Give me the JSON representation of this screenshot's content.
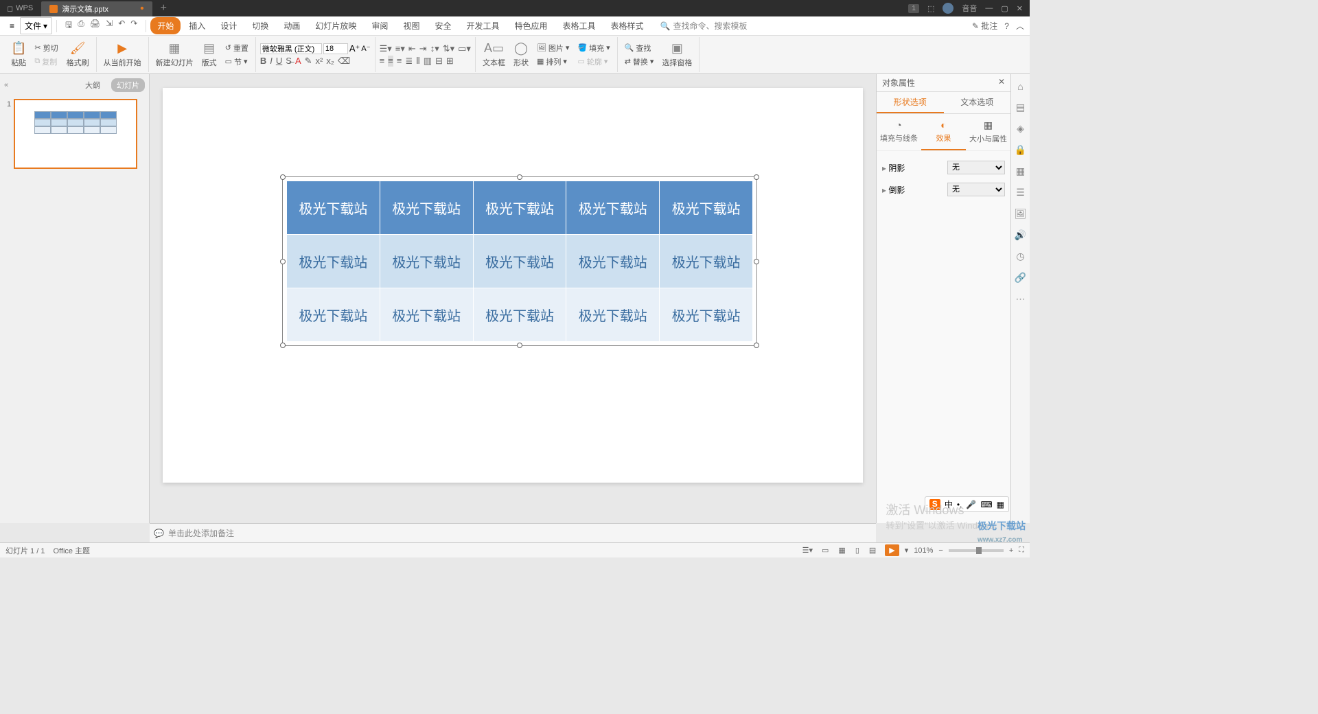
{
  "titlebar": {
    "app": "WPS",
    "doc_name": "演示文稿.pptx",
    "badge": "1",
    "username": "音音"
  },
  "menubar": {
    "file": "文件",
    "tabs": [
      "开始",
      "插入",
      "设计",
      "切换",
      "动画",
      "幻灯片放映",
      "审阅",
      "视图",
      "安全",
      "开发工具",
      "特色应用",
      "表格工具",
      "表格样式"
    ],
    "active_tab": 0,
    "search_placeholder": "查找命令、搜索模板",
    "annotate": "批注"
  },
  "ribbon": {
    "paste": "粘贴",
    "cut": "剪切",
    "copy": "复制",
    "format_painter": "格式刷",
    "from_start": "从当前开始",
    "new_slide": "新建幻灯片",
    "layout": "版式",
    "section": "节",
    "reset": "重置",
    "font_name": "微软雅黑 (正文)",
    "font_size": "18",
    "textbox": "文本框",
    "shape": "形状",
    "picture": "图片",
    "arrange": "排列",
    "fill": "填充",
    "outline": "轮廓",
    "find": "查找",
    "replace": "替换",
    "select_pane": "选择窗格"
  },
  "thumbpane": {
    "outline": "大纲",
    "slides": "幻灯片",
    "slide_number": "1"
  },
  "slide": {
    "cell_text": "极光下载站"
  },
  "proppane": {
    "title": "对象属性",
    "tab_shape": "形状选项",
    "tab_text": "文本选项",
    "sub_fill": "填充与线条",
    "sub_effect": "效果",
    "sub_size": "大小与属性",
    "shadow": "阴影",
    "reflection": "倒影",
    "none": "无"
  },
  "notes": {
    "placeholder": "单击此处添加备注"
  },
  "statusbar": {
    "slide_pos": "幻灯片 1 / 1",
    "theme": "Office 主题",
    "zoom": "101%"
  },
  "watermark": {
    "activate_title": "激活 Windows",
    "activate_sub": "转到\"设置\"以激活 Windows。",
    "logo": "极光下载站",
    "logo_url": "www.xz7.com"
  },
  "ime": {
    "lang": "中"
  }
}
